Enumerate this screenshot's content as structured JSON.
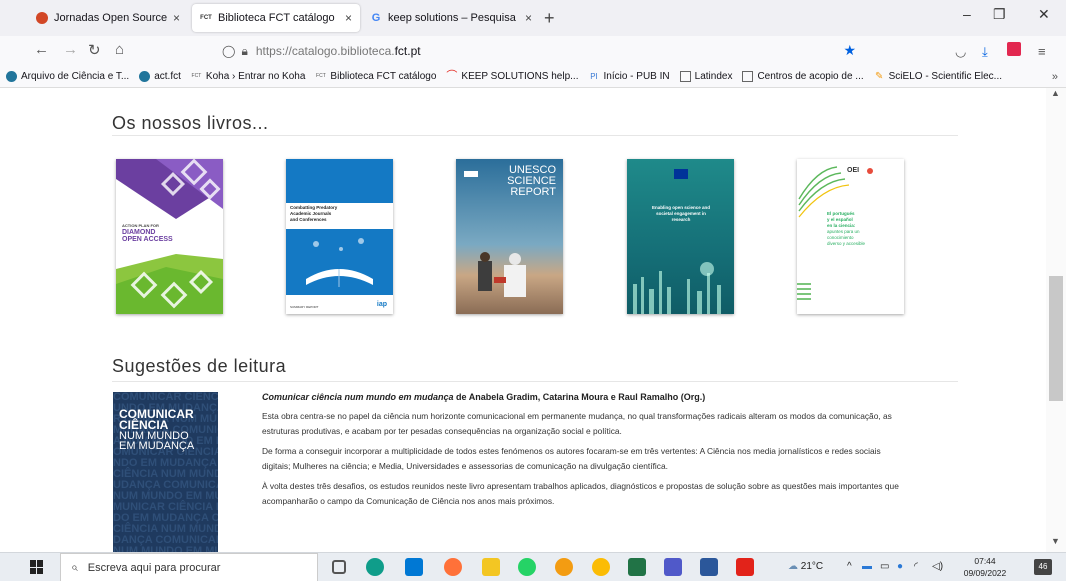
{
  "browser": {
    "tabs": [
      {
        "title": "Jornadas Open Source_Apresen",
        "favicon": "powerpoint-icon",
        "close": "×",
        "active": false
      },
      {
        "title": "Biblioteca FCT catálogo",
        "favicon": "FCT",
        "close": "×",
        "active": true
      },
      {
        "title": "keep solutions – Pesquisa Goog",
        "favicon": "G",
        "close": "×",
        "active": false
      }
    ],
    "new_tab": "+",
    "window_controls": {
      "minimize": "–",
      "restore": "❐",
      "close": "✕"
    },
    "nav": {
      "back": "←",
      "forward": "→",
      "reload": "↻",
      "home": "⌂"
    },
    "url": {
      "prefix": "https://catalogo.biblioteca.",
      "domain": "fct.pt"
    },
    "bookmarks": [
      {
        "label": "Arquivo de Ciência e T...",
        "icon": "wordpress-icon"
      },
      {
        "label": "act.fct",
        "icon": "wordpress-icon"
      },
      {
        "label": "Koha › Entrar no Koha",
        "icon": "fct-icon"
      },
      {
        "label": "Biblioteca FCT catálogo",
        "icon": "fct-icon"
      },
      {
        "label": "KEEP SOLUTIONS help...",
        "icon": "keep-icon"
      },
      {
        "label": "Início - PUB IN",
        "icon": "pub-icon"
      },
      {
        "label": "Latindex",
        "icon": "image-icon"
      },
      {
        "label": "Centros de acopio de ...",
        "icon": "image-icon"
      },
      {
        "label": "SciELO - Scientific Elec...",
        "icon": "scielo-icon"
      }
    ],
    "bookmarks_more": "»"
  },
  "page": {
    "books_title": "Os nossos livros...",
    "books": [
      {
        "name": "action-plan-diamond-open-access",
        "lines": [
          "ACTION PLAN FOR",
          "DIAMOND",
          "OPEN ACCESS"
        ]
      },
      {
        "name": "combatting-predatory-journals",
        "lines": [
          "Combatting Predatory",
          "Academic Journals",
          "and Conferences",
          "SUMMARY REPORT",
          "iap"
        ]
      },
      {
        "name": "unesco-science-report",
        "lines": [
          "UNESCO",
          "SCIENCE",
          "REPORT",
          "UNESCO"
        ]
      },
      {
        "name": "enabling-open-science",
        "lines": [
          "Enabling open science and",
          "societal engagement in",
          "research"
        ]
      },
      {
        "name": "el-portugues-y-el-espanol",
        "lines": [
          "OEI",
          "El portugués",
          "y el español",
          "en la ciencia:",
          "apuntes para un",
          "conocimiento",
          "diverso y accesible"
        ]
      }
    ],
    "suggestions_title": "Sugestões de leitura",
    "suggestion": {
      "cover_lines": [
        "COMUNICAR",
        "CIÊNCIA",
        "NUM MUNDO",
        "EM MUDANÇA"
      ],
      "cover_bg": "COMUNICAR CIÊNCIA NUM MUNDO EM MUDANÇA",
      "title": "Comunicar ciência num mundo em mudança",
      "authors": " de Anabela Gradim, Catarina Moura e Raul Ramalho (Org.)",
      "paragraphs": [
        "Esta obra centra-se no papel da ciência num horizonte comunicacional em permanente mudança, no qual transformações radicais alteram os modos da comunicação, as estruturas produtivas, e acabam por ter pesadas consequências na organização social e política.",
        "De forma a conseguir incorporar a multiplicidade de todos estes fenómenos os autores focaram-se em três vertentes: A Ciência nos media jornalísticos e redes sociais digitais; Mulheres na ciência; e Media, Universidades e assessorias de comunicação na divulgação científica.",
        "À volta destes três desafios, os estudos reunidos neste livro apresentam trabalhos aplicados, diagnósticos e propostas de solução sobre as questões mais importantes que acompanharão o campo da Comunicação de Ciência nos anos mais próximos."
      ]
    }
  },
  "taskbar": {
    "search_placeholder": "Escreva aqui para procurar",
    "weather": "21°C",
    "time": "07:44",
    "date": "09/09/2022",
    "notifications": "46"
  },
  "colors": {
    "accent": "#0061e0",
    "cover_navy": "#1f3a5f",
    "diamond_purple": "#6b3fa0",
    "diamond_green": "#8cc63f",
    "iap_blue": "#1479c4",
    "unesco_blue": "#2b6e9a",
    "oei_green": "#5cb85c"
  }
}
